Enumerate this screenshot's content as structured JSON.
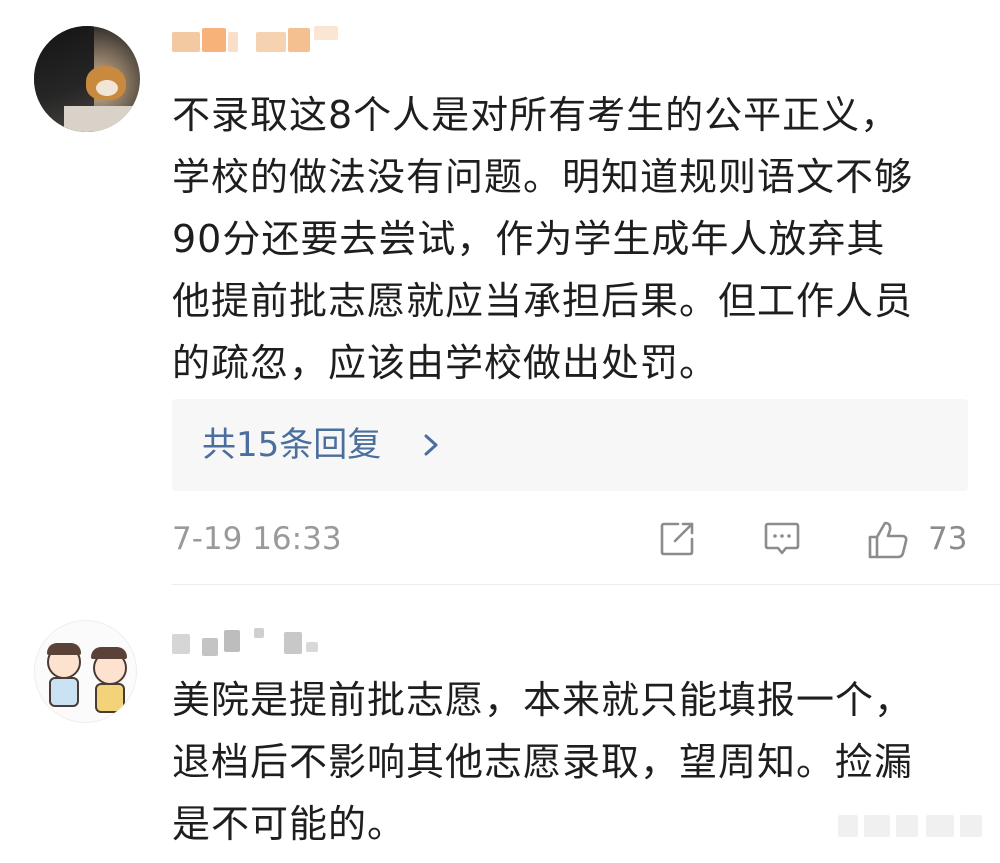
{
  "comments": [
    {
      "username": "",
      "text_lines": [
        "不录取这8个人是对所有考生的公平正义，",
        "学校的做法没有问题。明知道规则语文不够",
        "90分还要去尝试，作为学生成年人放弃其",
        "他提前批志愿就应当承担后果。但工作人员",
        "的疏忽，应该由学校做出处罚。"
      ],
      "replies_label": "共15条回复",
      "timestamp": "7-19 16:33",
      "like_count": "73",
      "icons": {
        "share": "share-icon",
        "reply": "comment-icon",
        "like": "thumbs-up-icon",
        "replies_arrow": "chevron-right-icon"
      }
    },
    {
      "username": "",
      "text_lines": [
        "美院是提前批志愿，本来就只能填报一个，",
        "退档后不影响其他志愿录取，望周知。捡漏",
        "是不可能的。"
      ]
    }
  ],
  "colors": {
    "link": "#4a6f9d",
    "meta": "#9a9a9a",
    "text": "#1e1e1e",
    "replies_bg": "#f7f7f7"
  }
}
